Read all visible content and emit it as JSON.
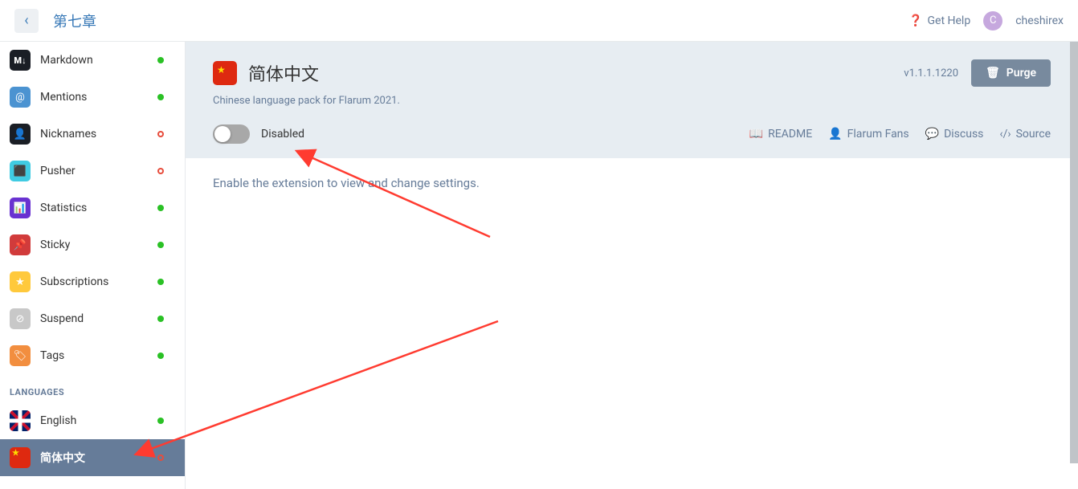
{
  "header": {
    "breadcrumb": "第七章",
    "help": "Get Help",
    "username": "cheshirex",
    "avatar_initial": "C"
  },
  "sidebar": {
    "items": [
      {
        "label": "Markdown",
        "icon": "markdown",
        "status": "enabled",
        "glyph": "M↓"
      },
      {
        "label": "Mentions",
        "icon": "mentions",
        "status": "enabled",
        "glyph": "@"
      },
      {
        "label": "Nicknames",
        "icon": "nicknames",
        "status": "disabled",
        "glyph": "👤"
      },
      {
        "label": "Pusher",
        "icon": "pusher",
        "status": "disabled",
        "glyph": "⬛"
      },
      {
        "label": "Statistics",
        "icon": "statistics",
        "status": "enabled",
        "glyph": "📊"
      },
      {
        "label": "Sticky",
        "icon": "sticky",
        "status": "enabled",
        "glyph": "📌"
      },
      {
        "label": "Subscriptions",
        "icon": "subscriptions",
        "status": "enabled",
        "glyph": "★"
      },
      {
        "label": "Suspend",
        "icon": "suspend",
        "status": "enabled",
        "glyph": "⊘"
      },
      {
        "label": "Tags",
        "icon": "tags",
        "status": "enabled",
        "glyph": "🏷"
      }
    ],
    "languages_header": "LANGUAGES",
    "languages": [
      {
        "label": "English",
        "icon": "english",
        "status": "enabled",
        "active": false
      },
      {
        "label": "简体中文",
        "icon": "chinese",
        "status": "disabled",
        "active": true
      }
    ]
  },
  "extension": {
    "title": "简体中文",
    "description": "Chinese language pack for Flarum 2021.",
    "version": "v1.1.1.1220",
    "purge": "Purge",
    "toggle_state": "Disabled",
    "links": {
      "readme": "README",
      "author": "Flarum Fans",
      "discuss": "Discuss",
      "source": "Source"
    },
    "enable_msg": "Enable the extension to view and change settings."
  }
}
